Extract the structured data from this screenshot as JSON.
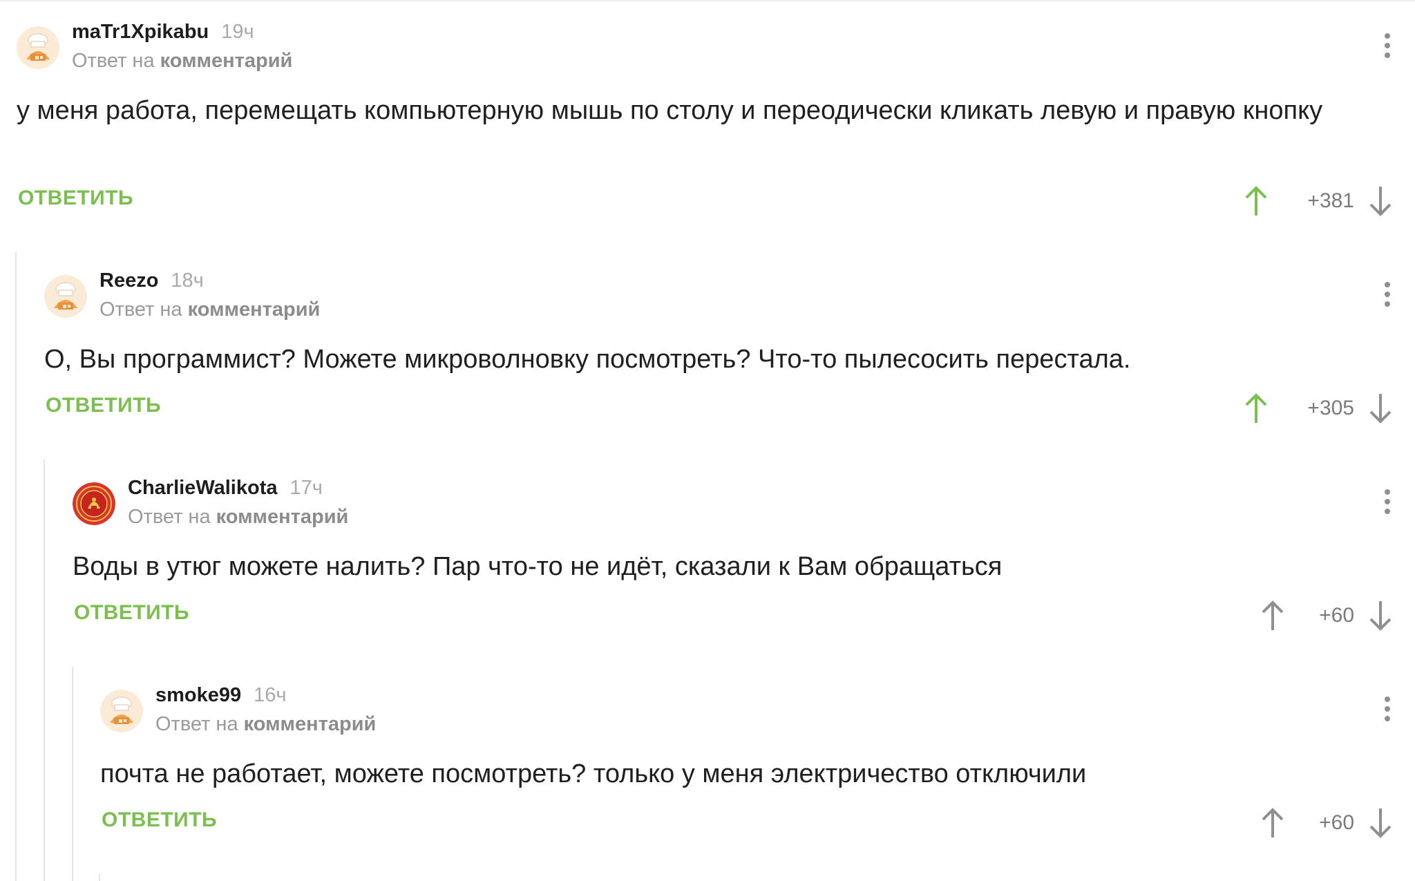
{
  "reply_prefix": "Ответ на",
  "reply_target": "комментарий",
  "reply_button": "ОТВЕТИТЬ",
  "colors": {
    "accent_green": "#7bbf4e",
    "upvoted_green": "#7bbf4e",
    "neutral_gray": "#8f8f8f"
  },
  "comments": [
    {
      "author": "maTr1Xpikabu",
      "time": "19ч",
      "text": "у меня работа, перемещать компьютерную мышь по столу и переодически кликать левую и правую кнопку",
      "score": "+381",
      "upvoted": true,
      "avatar_icon": "pikabu-chef-avatar-icon"
    },
    {
      "author": "Reezo",
      "time": "18ч",
      "text": "О, Вы программист? Можете микроволновку посмотреть? Что-то пылесосить перестала.",
      "score": "+305",
      "upvoted": true,
      "avatar_icon": "pikabu-chef-avatar-icon"
    },
    {
      "author": "CharlieWalikota",
      "time": "17ч",
      "text": "Воды в утюг можете налить? Пар что-то не идёт, сказали к Вам обращаться",
      "score": "+60",
      "upvoted": false,
      "avatar_icon": "emblem-avatar-icon"
    },
    {
      "author": "smoke99",
      "time": "16ч",
      "text": "почта не работает, можете посмотреть? только у меня электричество отключили",
      "score": "+60",
      "upvoted": false,
      "avatar_icon": "pikabu-chef-avatar-icon"
    }
  ]
}
